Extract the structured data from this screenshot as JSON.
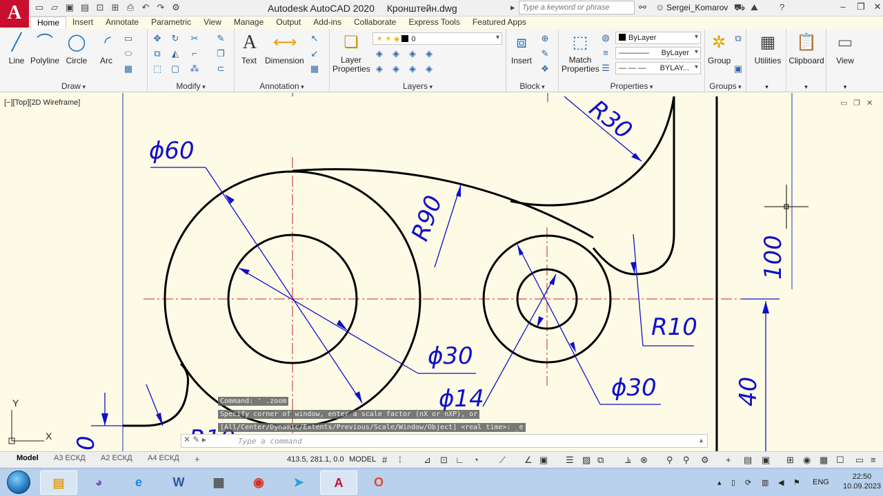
{
  "app": {
    "title": "Autodesk AutoCAD 2020",
    "file_name": "Кронштейн.dwg",
    "search_placeholder": "Type a keyword or phrase",
    "user": "Sergei_Komarov"
  },
  "ribbon_tabs": [
    "Home",
    "Insert",
    "Annotate",
    "Parametric",
    "View",
    "Manage",
    "Output",
    "Add-ins",
    "Collaborate",
    "Express Tools",
    "Featured Apps"
  ],
  "panels": {
    "draw": {
      "title": "Draw",
      "tools": [
        "Line",
        "Polyline",
        "Circle",
        "Arc"
      ]
    },
    "modify": {
      "title": "Modify"
    },
    "annotation": {
      "title": "Annotation",
      "tools": [
        "Text",
        "Dimension"
      ]
    },
    "layers": {
      "title": "Layers",
      "layer_properties_label": "Layer Properties",
      "current_layer": "0"
    },
    "block": {
      "title": "Block",
      "insert_label": "Insert"
    },
    "properties": {
      "title": "Properties",
      "match_label": "Match Properties",
      "color": "ByLayer",
      "linetype": "ByLayer",
      "lineweight": "BYLAY..."
    },
    "groups": {
      "title": "Groups",
      "group_label": "Group"
    },
    "utilities": {
      "label": "Utilities"
    },
    "clipboard": {
      "label": "Clipboard"
    },
    "view": {
      "label": "View"
    }
  },
  "viewport": {
    "label": "[−][Top][2D Wireframe]",
    "axis_x": "X",
    "axis_y": "Y"
  },
  "dimensions": {
    "d60": "ϕ60",
    "r30": "R30",
    "r90": "R90",
    "h100": "100",
    "r10_right": "R10",
    "d30_left": "ϕ30",
    "d14": "ϕ14",
    "d30_right": "ϕ30",
    "h40": "40",
    "r10_bottom": "R10",
    "partial_zero": "0"
  },
  "command_line": {
    "history": [
      "Command: ' .zoom",
      "Specify corner of window, enter a scale factor (nX or nXP), or",
      "[All/Center/Dynamic/Extents/Previous/Scale/Window/Object] <real time>: _e"
    ],
    "placeholder": "Type a command"
  },
  "statusbar": {
    "layout_tabs": [
      "Model",
      "A3 ЕСКД",
      "A2 ЕСКД",
      "A4 ЕСКД"
    ],
    "coordinates": "413.5, 281.1, 0.0",
    "space": "MODEL"
  },
  "taskbar": {
    "apps": [
      "explorer",
      "viber",
      "internet-explorer",
      "word",
      "calculator",
      "chrome",
      "telegram",
      "autocad",
      "office"
    ],
    "lang": "ENG",
    "time": "22:50",
    "date": "10.09.2023"
  },
  "colors": {
    "drawing_bg": "#fdfbe6",
    "dimension": "#1010c8",
    "center_line": "#cc2020",
    "object_line": "#000000",
    "brand": "#c8102e"
  }
}
